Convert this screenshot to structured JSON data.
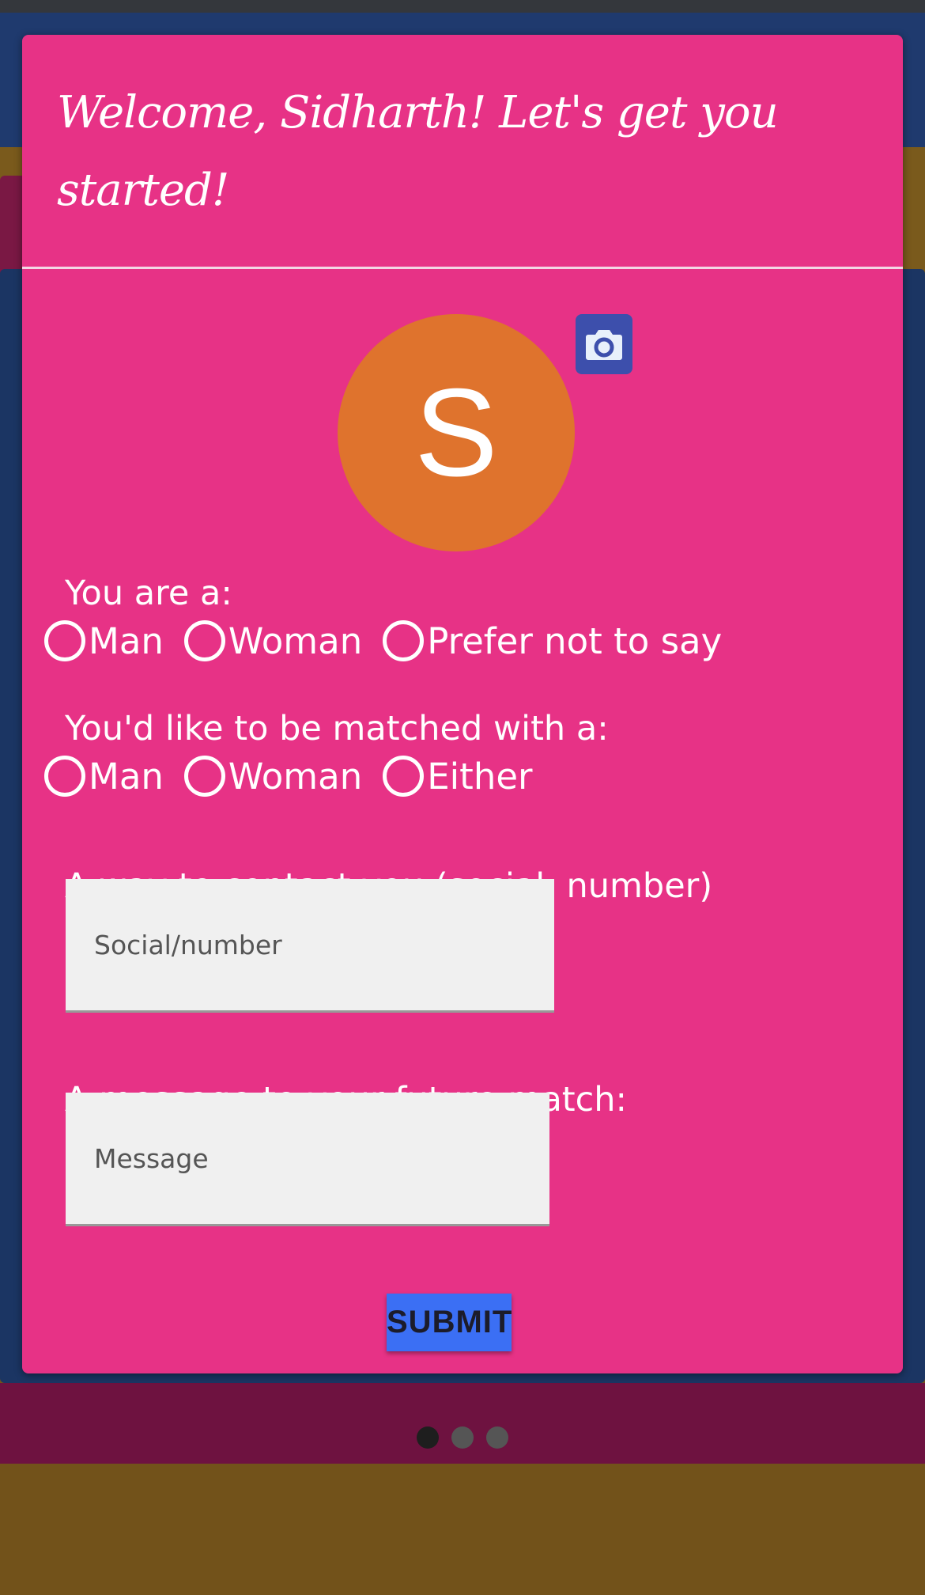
{
  "dialog": {
    "title": "Welcome, Sidharth! Let's get you started!",
    "avatar_letter": "S"
  },
  "gender": {
    "label": "You are a:",
    "options": [
      "Man",
      "Woman",
      "Prefer not to say"
    ]
  },
  "match": {
    "label": "You'd like to be matched with a:",
    "options": [
      "Man",
      "Woman",
      "Either"
    ]
  },
  "contact": {
    "label": "A way to contact you (social, number)",
    "placeholder": "Social/number"
  },
  "message": {
    "label": "A message to your future match:",
    "placeholder": "Message"
  },
  "submit_label": "SUBMIT",
  "pager": {
    "count": 3,
    "active_index": 0
  },
  "colors": {
    "dialog": "#e73286",
    "avatar": "#df732d",
    "camera_button": "#3d4fac",
    "submit": "#3b6ff4"
  }
}
